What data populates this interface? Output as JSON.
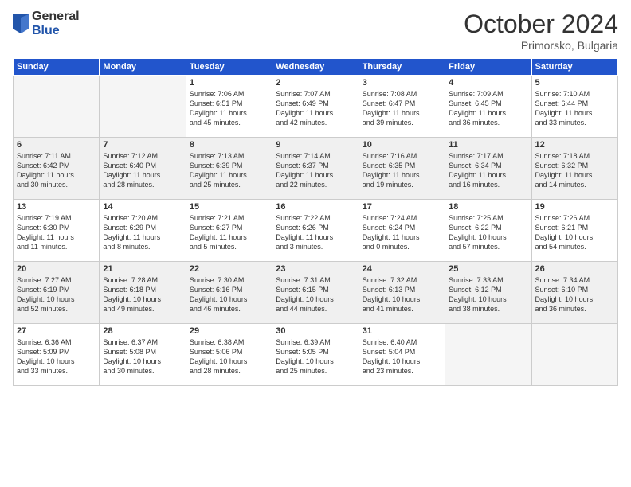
{
  "header": {
    "logo_general": "General",
    "logo_blue": "Blue",
    "month_title": "October 2024",
    "location": "Primorsko, Bulgaria"
  },
  "weekdays": [
    "Sunday",
    "Monday",
    "Tuesday",
    "Wednesday",
    "Thursday",
    "Friday",
    "Saturday"
  ],
  "weeks": [
    [
      {
        "day": "",
        "content": ""
      },
      {
        "day": "",
        "content": ""
      },
      {
        "day": "1",
        "content": "Sunrise: 7:06 AM\nSunset: 6:51 PM\nDaylight: 11 hours\nand 45 minutes."
      },
      {
        "day": "2",
        "content": "Sunrise: 7:07 AM\nSunset: 6:49 PM\nDaylight: 11 hours\nand 42 minutes."
      },
      {
        "day": "3",
        "content": "Sunrise: 7:08 AM\nSunset: 6:47 PM\nDaylight: 11 hours\nand 39 minutes."
      },
      {
        "day": "4",
        "content": "Sunrise: 7:09 AM\nSunset: 6:45 PM\nDaylight: 11 hours\nand 36 minutes."
      },
      {
        "day": "5",
        "content": "Sunrise: 7:10 AM\nSunset: 6:44 PM\nDaylight: 11 hours\nand 33 minutes."
      }
    ],
    [
      {
        "day": "6",
        "content": "Sunrise: 7:11 AM\nSunset: 6:42 PM\nDaylight: 11 hours\nand 30 minutes."
      },
      {
        "day": "7",
        "content": "Sunrise: 7:12 AM\nSunset: 6:40 PM\nDaylight: 11 hours\nand 28 minutes."
      },
      {
        "day": "8",
        "content": "Sunrise: 7:13 AM\nSunset: 6:39 PM\nDaylight: 11 hours\nand 25 minutes."
      },
      {
        "day": "9",
        "content": "Sunrise: 7:14 AM\nSunset: 6:37 PM\nDaylight: 11 hours\nand 22 minutes."
      },
      {
        "day": "10",
        "content": "Sunrise: 7:16 AM\nSunset: 6:35 PM\nDaylight: 11 hours\nand 19 minutes."
      },
      {
        "day": "11",
        "content": "Sunrise: 7:17 AM\nSunset: 6:34 PM\nDaylight: 11 hours\nand 16 minutes."
      },
      {
        "day": "12",
        "content": "Sunrise: 7:18 AM\nSunset: 6:32 PM\nDaylight: 11 hours\nand 14 minutes."
      }
    ],
    [
      {
        "day": "13",
        "content": "Sunrise: 7:19 AM\nSunset: 6:30 PM\nDaylight: 11 hours\nand 11 minutes."
      },
      {
        "day": "14",
        "content": "Sunrise: 7:20 AM\nSunset: 6:29 PM\nDaylight: 11 hours\nand 8 minutes."
      },
      {
        "day": "15",
        "content": "Sunrise: 7:21 AM\nSunset: 6:27 PM\nDaylight: 11 hours\nand 5 minutes."
      },
      {
        "day": "16",
        "content": "Sunrise: 7:22 AM\nSunset: 6:26 PM\nDaylight: 11 hours\nand 3 minutes."
      },
      {
        "day": "17",
        "content": "Sunrise: 7:24 AM\nSunset: 6:24 PM\nDaylight: 11 hours\nand 0 minutes."
      },
      {
        "day": "18",
        "content": "Sunrise: 7:25 AM\nSunset: 6:22 PM\nDaylight: 10 hours\nand 57 minutes."
      },
      {
        "day": "19",
        "content": "Sunrise: 7:26 AM\nSunset: 6:21 PM\nDaylight: 10 hours\nand 54 minutes."
      }
    ],
    [
      {
        "day": "20",
        "content": "Sunrise: 7:27 AM\nSunset: 6:19 PM\nDaylight: 10 hours\nand 52 minutes."
      },
      {
        "day": "21",
        "content": "Sunrise: 7:28 AM\nSunset: 6:18 PM\nDaylight: 10 hours\nand 49 minutes."
      },
      {
        "day": "22",
        "content": "Sunrise: 7:30 AM\nSunset: 6:16 PM\nDaylight: 10 hours\nand 46 minutes."
      },
      {
        "day": "23",
        "content": "Sunrise: 7:31 AM\nSunset: 6:15 PM\nDaylight: 10 hours\nand 44 minutes."
      },
      {
        "day": "24",
        "content": "Sunrise: 7:32 AM\nSunset: 6:13 PM\nDaylight: 10 hours\nand 41 minutes."
      },
      {
        "day": "25",
        "content": "Sunrise: 7:33 AM\nSunset: 6:12 PM\nDaylight: 10 hours\nand 38 minutes."
      },
      {
        "day": "26",
        "content": "Sunrise: 7:34 AM\nSunset: 6:10 PM\nDaylight: 10 hours\nand 36 minutes."
      }
    ],
    [
      {
        "day": "27",
        "content": "Sunrise: 6:36 AM\nSunset: 5:09 PM\nDaylight: 10 hours\nand 33 minutes."
      },
      {
        "day": "28",
        "content": "Sunrise: 6:37 AM\nSunset: 5:08 PM\nDaylight: 10 hours\nand 30 minutes."
      },
      {
        "day": "29",
        "content": "Sunrise: 6:38 AM\nSunset: 5:06 PM\nDaylight: 10 hours\nand 28 minutes."
      },
      {
        "day": "30",
        "content": "Sunrise: 6:39 AM\nSunset: 5:05 PM\nDaylight: 10 hours\nand 25 minutes."
      },
      {
        "day": "31",
        "content": "Sunrise: 6:40 AM\nSunset: 5:04 PM\nDaylight: 10 hours\nand 23 minutes."
      },
      {
        "day": "",
        "content": ""
      },
      {
        "day": "",
        "content": ""
      }
    ]
  ]
}
